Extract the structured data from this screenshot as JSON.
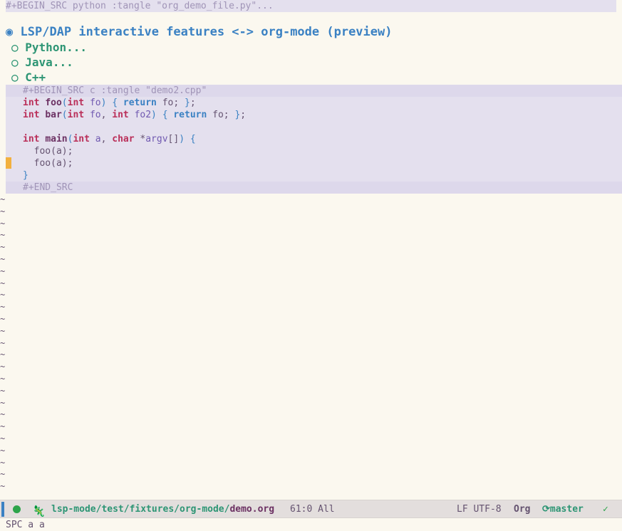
{
  "editor": {
    "python_header": "#+BEGIN_SRC python :tangle \"org_demo_file.py\"...",
    "heading_bullet": "◉",
    "heading": "LSP/DAP interactive features <-> org-mode (preview)",
    "subheadings": [
      {
        "bullet": "○",
        "title": "Python..."
      },
      {
        "bullet": "○",
        "title": "Java..."
      },
      {
        "bullet": "○",
        "title": "C++"
      }
    ],
    "c_begin": "#+BEGIN_SRC c :tangle \"demo2.cpp\"",
    "c_end": "#+END_SRC",
    "tilde": "~"
  },
  "modeline": {
    "path_dir": "lsp-mode/test/fixtures/org-mode/",
    "path_file": "demo.org",
    "position": "61:0 All",
    "encoding": "LF UTF-8",
    "mode": "Org",
    "branch": "master",
    "check": "✓"
  },
  "minibuffer": "SPC a a",
  "colors": {
    "background": "#fbf8ef",
    "block_bg": "#e4e0ee",
    "heading": "#3a81c3",
    "subheading": "#2d9574",
    "keyword": "#3a81c3",
    "type": "#ba2f59",
    "function": "#6c3163",
    "fringe_mark": "#f2b03e"
  }
}
